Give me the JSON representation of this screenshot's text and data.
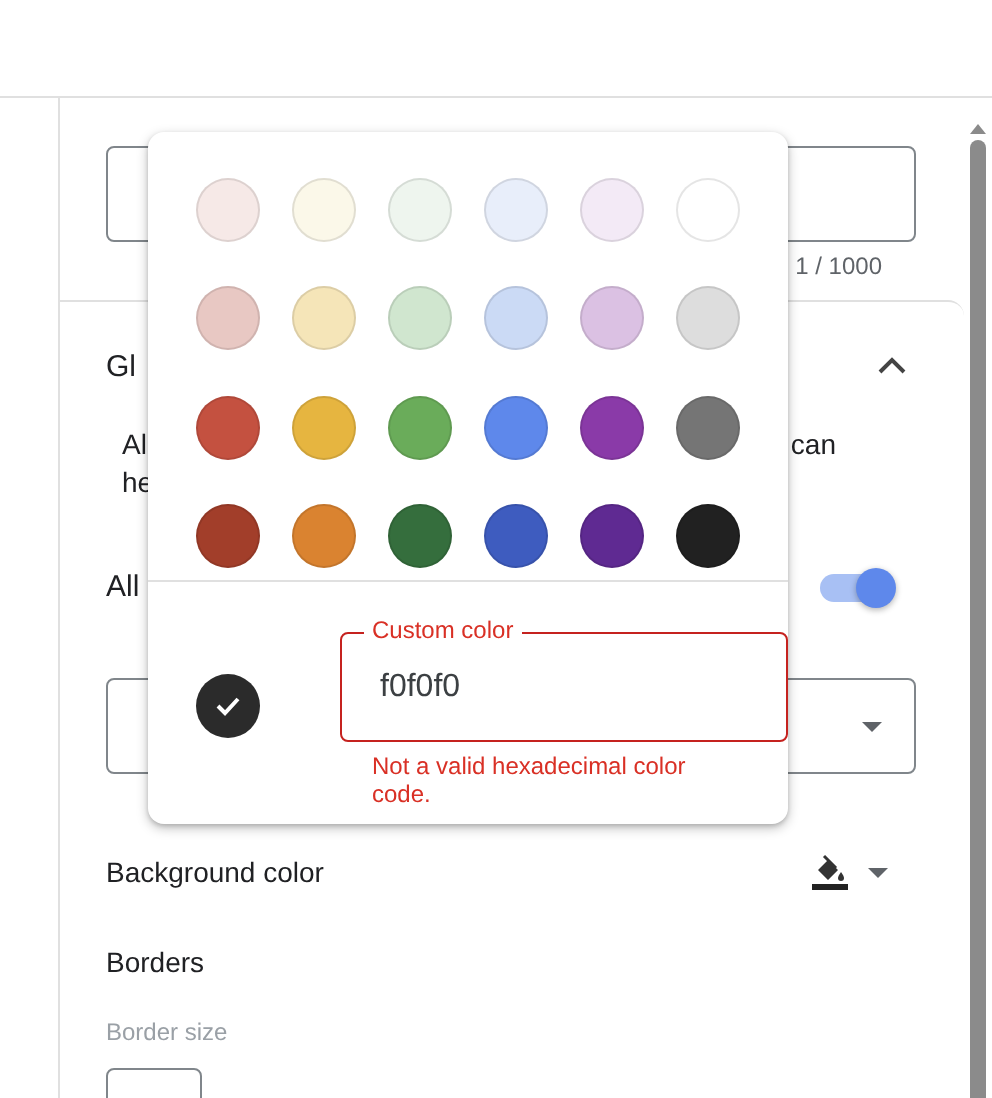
{
  "description_field": {
    "counter": "1 / 1000"
  },
  "section": {
    "title": "Gl",
    "expanded": true,
    "text_left": "Al",
    "text_right": "can",
    "text_line2": "he"
  },
  "allow_toggle": {
    "label": "All",
    "on": true
  },
  "background_color": {
    "label": "Background color"
  },
  "borders": {
    "title": "Borders",
    "size_label": "Border size"
  },
  "color_picker": {
    "swatches": [
      {
        "color": "#f6e9e7",
        "selected": false
      },
      {
        "color": "#fbf8e9",
        "selected": false
      },
      {
        "color": "#eef5ee",
        "selected": false
      },
      {
        "color": "#e8eefa",
        "selected": false
      },
      {
        "color": "#f3eaf6",
        "selected": false
      },
      {
        "color": "#ffffff",
        "selected": false
      },
      {
        "color": "#e8c8c3",
        "selected": false
      },
      {
        "color": "#f5e5b8",
        "selected": false
      },
      {
        "color": "#d0e6cf",
        "selected": false
      },
      {
        "color": "#cbdaf5",
        "selected": false
      },
      {
        "color": "#dbc1e3",
        "selected": false
      },
      {
        "color": "#dddddd",
        "selected": false
      },
      {
        "color": "#c45140",
        "selected": false
      },
      {
        "color": "#e6b540",
        "selected": false
      },
      {
        "color": "#6aac5a",
        "selected": false
      },
      {
        "color": "#5e88eb",
        "selected": false
      },
      {
        "color": "#8a3aa8",
        "selected": false
      },
      {
        "color": "#757575",
        "selected": false
      },
      {
        "color": "#a23e2a",
        "selected": false
      },
      {
        "color": "#da8330",
        "selected": false
      },
      {
        "color": "#356e3d",
        "selected": false
      },
      {
        "color": "#3e5cbf",
        "selected": false
      },
      {
        "color": "#5f2a92",
        "selected": false
      },
      {
        "color": "#212121",
        "selected": false
      }
    ],
    "custom": {
      "selected": true,
      "color": "#2b2b2b",
      "label": "Custom color",
      "value": "f0f0f0",
      "invalid": true,
      "error": "Not a valid hexadecimal color code."
    }
  }
}
